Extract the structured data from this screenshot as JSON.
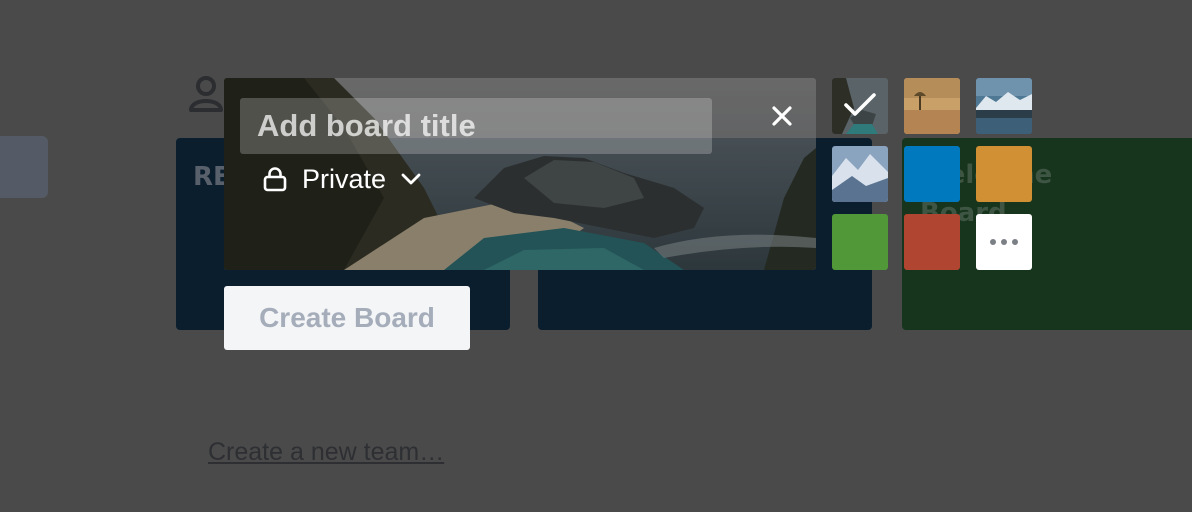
{
  "background_page": {
    "boards": [
      {
        "title": "RE",
        "color": "#0b1e2e"
      },
      {
        "title": "",
        "color": "#0b1e2e"
      },
      {
        "title": "Welcome Board",
        "color": "#17341d"
      }
    ],
    "create_team_link": "Create a new team…"
  },
  "create_board_modal": {
    "title_input": {
      "value": "",
      "placeholder": "Add board title"
    },
    "privacy": {
      "label": "Private",
      "icon": "lock-icon"
    },
    "close_icon": "close-icon",
    "selected_background": "photo-coast",
    "background_options": [
      {
        "id": "photo-coast",
        "kind": "photo",
        "selected": true
      },
      {
        "id": "photo-savanna",
        "kind": "photo",
        "selected": false
      },
      {
        "id": "photo-glacier-lake",
        "kind": "photo",
        "selected": false
      },
      {
        "id": "photo-snowy-mountains",
        "kind": "photo",
        "selected": false
      },
      {
        "id": "color-blue",
        "kind": "color",
        "color": "#0079bf",
        "selected": false
      },
      {
        "id": "color-orange",
        "kind": "color",
        "color": "#d29034",
        "selected": false
      },
      {
        "id": "color-green",
        "kind": "color",
        "color": "#519839",
        "selected": false
      },
      {
        "id": "color-red",
        "kind": "color",
        "color": "#b04632",
        "selected": false
      },
      {
        "id": "more",
        "kind": "more",
        "icon": "more-icon",
        "selected": false
      }
    ],
    "create_button": {
      "label": "Create Board",
      "disabled": true
    }
  }
}
